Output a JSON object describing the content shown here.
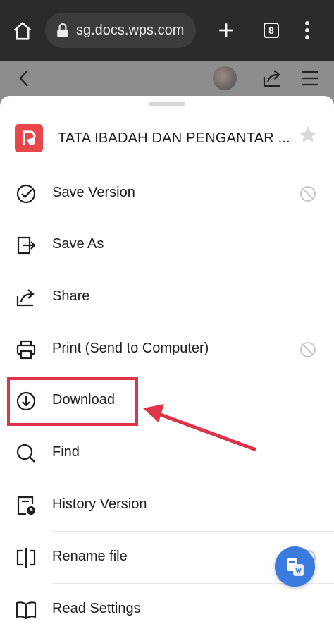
{
  "browser": {
    "url": "sg.docs.wps.com",
    "tab_count": "8"
  },
  "document": {
    "title": "TATA IBADAH DAN PENGANTAR ..."
  },
  "menu": {
    "items": [
      {
        "label": "Save Version",
        "icon": "save-version-icon",
        "disabled_badge": true
      },
      {
        "label": "Save As",
        "icon": "save-as-icon",
        "disabled_badge": false
      },
      {
        "label": "Share",
        "icon": "share-icon",
        "disabled_badge": false
      },
      {
        "label": "Print (Send to Computer)",
        "icon": "print-icon",
        "disabled_badge": true
      },
      {
        "label": "Download",
        "icon": "download-icon",
        "disabled_badge": false
      },
      {
        "label": "Find",
        "icon": "search-icon",
        "disabled_badge": false
      },
      {
        "label": "History Version",
        "icon": "history-icon",
        "disabled_badge": false
      },
      {
        "label": "Rename file",
        "icon": "rename-icon",
        "disabled_badge": true
      },
      {
        "label": "Read Settings",
        "icon": "book-icon",
        "disabled_badge": false
      }
    ]
  },
  "colors": {
    "highlight": "#e0334a",
    "fab": "#3b7be0",
    "logo": "#e8464b"
  }
}
